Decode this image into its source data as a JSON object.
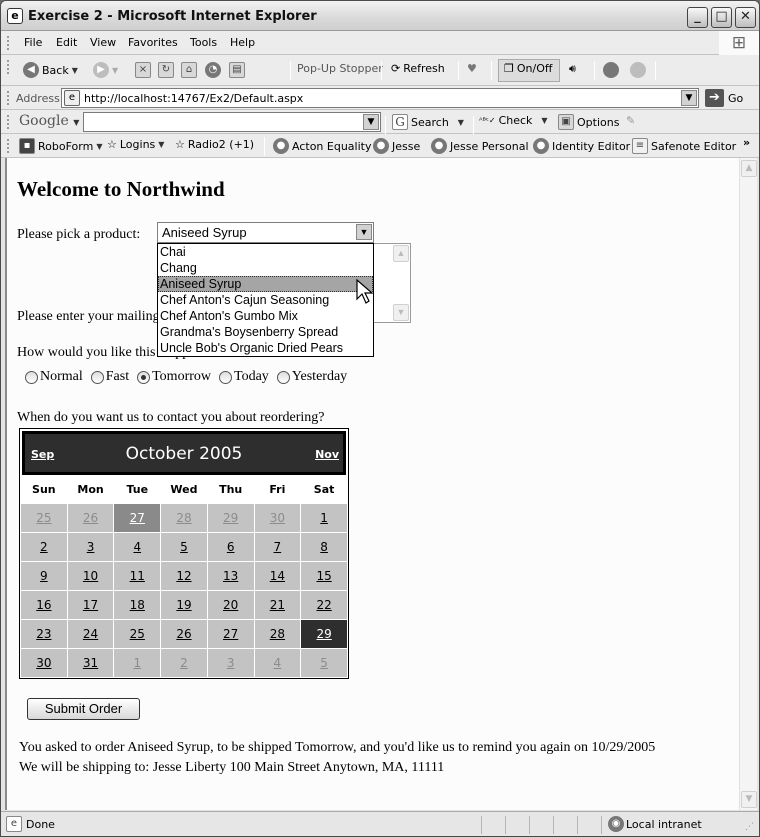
{
  "window": {
    "title": "Exercise 2 - Microsoft Internet Explorer",
    "controls": [
      "minimize",
      "maximize",
      "close"
    ]
  },
  "menubar": {
    "items": [
      "File",
      "Edit",
      "View",
      "Favorites",
      "Tools",
      "Help"
    ]
  },
  "toolbar": {
    "back_label": "Back",
    "popup_stopper_label": "Pop-Up Stopper",
    "refresh_label": "Refresh",
    "onoff_label": "On/Off"
  },
  "addressbar": {
    "label": "Address",
    "url": "http://localhost:14767/Ex2/Default.aspx",
    "go_label": "Go"
  },
  "googlebar": {
    "logo": "Google",
    "search_value": "",
    "search_label": "Search",
    "check_label": "Check",
    "options_label": "Options"
  },
  "linksbar": {
    "items": [
      "RoboForm",
      "Logins",
      "Radio2 (+1)",
      "Acton Equality",
      "Jesse",
      "Jesse Personal",
      "Identity Editor",
      "Safenote Editor"
    ],
    "overflow": "»"
  },
  "page": {
    "heading": "Welcome to Northwind",
    "product_label": "Please pick a product:",
    "product_selected": "Aniseed Syrup",
    "product_options": [
      "Chai",
      "Chang",
      "Aniseed Syrup",
      "Chef Anton's Cajun Seasoning",
      "Chef Anton's Gumbo Mix",
      "Grandma's Boysenberry Spread",
      "Uncle Bob's Organic Dried Pears"
    ],
    "mailing_label": "Please enter your mailing address:",
    "shipping_label": "How would you like this shipped?",
    "shipping_options": [
      "Normal",
      "Fast",
      "Tomorrow",
      "Today",
      "Yesterday"
    ],
    "shipping_selected": "Tomorrow",
    "reorder_label": "When do you want us to contact you about reordering?",
    "submit_label": "Submit Order",
    "result_line1": "You asked to order Aniseed Syrup, to be shipped Tomorrow, and you'd like us to remind you again on 10/29/2005",
    "result_line2": "We will be shipping to: Jesse Liberty 100 Main Street Anytown, MA, 11111"
  },
  "calendar": {
    "prev_label": "Sep",
    "next_label": "Nov",
    "month_title": "October 2005",
    "day_headers": [
      "Sun",
      "Mon",
      "Tue",
      "Wed",
      "Thu",
      "Fri",
      "Sat"
    ],
    "weeks": [
      [
        {
          "d": "25",
          "other": true
        },
        {
          "d": "26",
          "other": true
        },
        {
          "d": "27",
          "other": true,
          "today": true
        },
        {
          "d": "28",
          "other": true
        },
        {
          "d": "29",
          "other": true
        },
        {
          "d": "30",
          "other": true
        },
        {
          "d": "1"
        }
      ],
      [
        {
          "d": "2"
        },
        {
          "d": "3"
        },
        {
          "d": "4"
        },
        {
          "d": "5"
        },
        {
          "d": "6"
        },
        {
          "d": "7"
        },
        {
          "d": "8"
        }
      ],
      [
        {
          "d": "9"
        },
        {
          "d": "10"
        },
        {
          "d": "11"
        },
        {
          "d": "12"
        },
        {
          "d": "13"
        },
        {
          "d": "14"
        },
        {
          "d": "15"
        }
      ],
      [
        {
          "d": "16"
        },
        {
          "d": "17"
        },
        {
          "d": "18"
        },
        {
          "d": "19"
        },
        {
          "d": "20"
        },
        {
          "d": "21"
        },
        {
          "d": "22"
        }
      ],
      [
        {
          "d": "23"
        },
        {
          "d": "24"
        },
        {
          "d": "25"
        },
        {
          "d": "26"
        },
        {
          "d": "27"
        },
        {
          "d": "28"
        },
        {
          "d": "29",
          "selected": true
        }
      ],
      [
        {
          "d": "30"
        },
        {
          "d": "31"
        },
        {
          "d": "1",
          "other": true
        },
        {
          "d": "2",
          "other": true
        },
        {
          "d": "3",
          "other": true
        },
        {
          "d": "4",
          "other": true
        },
        {
          "d": "5",
          "other": true
        }
      ]
    ]
  },
  "statusbar": {
    "status": "Done",
    "zone": "Local intranet"
  }
}
